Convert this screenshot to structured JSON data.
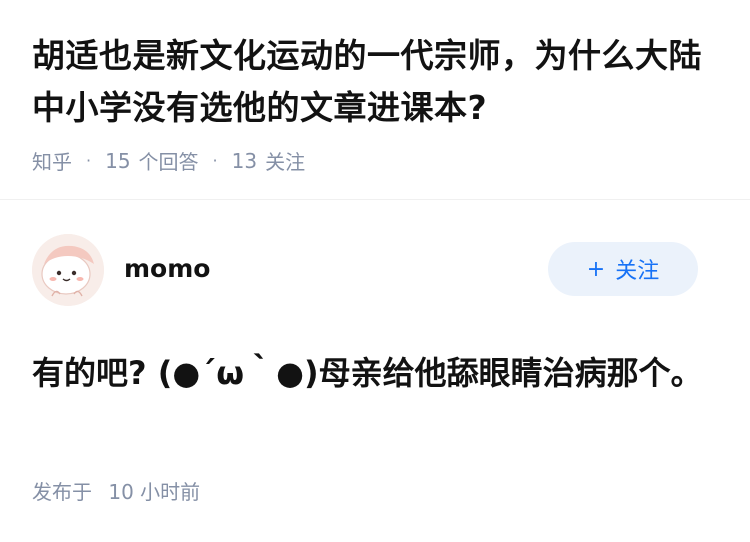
{
  "question": {
    "title": "胡适也是新文化运动的一代宗师，为什么大陆中小学没有选他的文章进课本?",
    "source": "知乎",
    "answer_count": "15",
    "answer_label": "个回答",
    "follow_count": "13",
    "follow_label": "关注"
  },
  "answer": {
    "author_name": "momo",
    "follow_button_label": "关注",
    "follow_button_icon": "plus-icon",
    "text": "有的吧? (●´ω｀●)母亲给他舔眼睛治病那个。",
    "time_prefix": "发布于",
    "time_value": "10 小时前"
  },
  "colors": {
    "text": "#121212",
    "meta": "#8590a6",
    "accent": "#1772f6",
    "button_bg": "#ebf2fb"
  }
}
